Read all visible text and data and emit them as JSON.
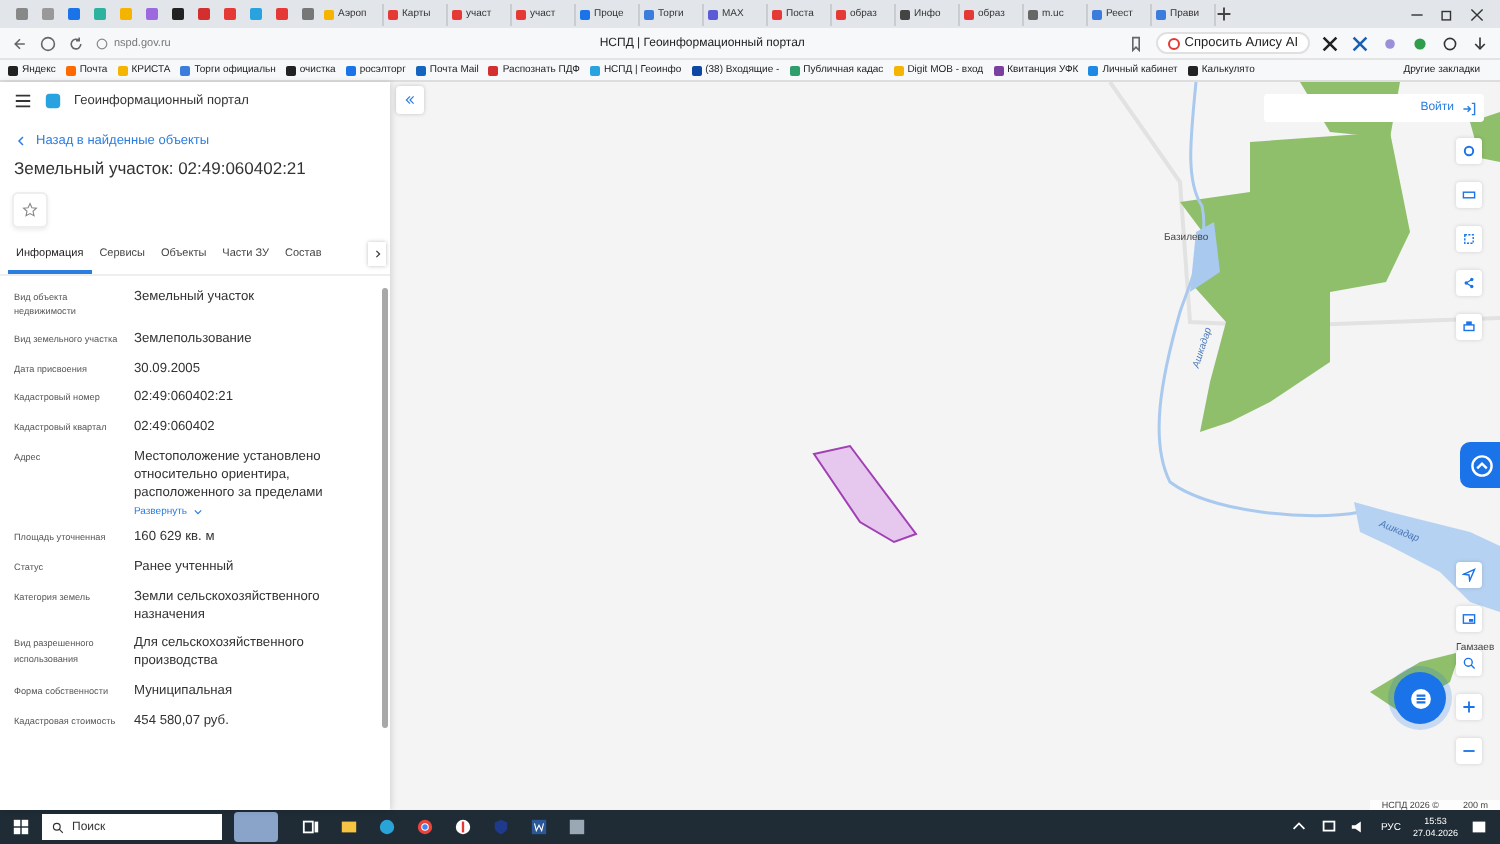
{
  "browser": {
    "tabs": [
      {
        "title": "Аэроп",
        "color": "#f5b400"
      },
      {
        "title": "Карты",
        "color": "#e53935"
      },
      {
        "title": "участ",
        "color": "#e53935"
      },
      {
        "title": "участ",
        "color": "#e53935"
      },
      {
        "title": "Проце",
        "color": "#1a73e8"
      },
      {
        "title": "Торги",
        "color": "#3b7ddd"
      },
      {
        "title": "MAX",
        "color": "#5b5bd6"
      },
      {
        "title": "Поста",
        "color": "#e53935"
      },
      {
        "title": "образ",
        "color": "#e53935"
      },
      {
        "title": "Инфо",
        "color": "#444444"
      },
      {
        "title": "образ",
        "color": "#e53935"
      },
      {
        "title": "m.uc",
        "color": "#666666"
      },
      {
        "title": "Реест",
        "color": "#3b7ddd"
      },
      {
        "title": "Прави",
        "color": "#3b7ddd"
      }
    ],
    "url": "nspd.gov.ru",
    "page_title": "НСПД | Геоинформационный портал",
    "alice_button": "Спросить Алису AI",
    "bookmarks": [
      {
        "label": "Яндекс",
        "color": "#222222"
      },
      {
        "label": "Почта",
        "color": "#ff6a00"
      },
      {
        "label": "КРИСТА",
        "color": "#f5b400"
      },
      {
        "label": "Торги официальн",
        "color": "#3b7ddd"
      },
      {
        "label": "очистка",
        "color": "#222222"
      },
      {
        "label": "росэлторг",
        "color": "#1a73e8"
      },
      {
        "label": "Почта Mail",
        "color": "#1565c0"
      },
      {
        "label": "Распознать ПДФ",
        "color": "#d32f2f"
      },
      {
        "label": "НСПД | Геоинфо",
        "color": "#29a3e0"
      },
      {
        "label": "(38) Входящие -",
        "color": "#0d47a1"
      },
      {
        "label": "Публичная кадас",
        "color": "#2e9e6a"
      },
      {
        "label": "Digit МОВ - вход",
        "color": "#f5b400"
      },
      {
        "label": "Квитанция УФК",
        "color": "#7b3fa0"
      },
      {
        "label": "Личный кабинет",
        "color": "#1e88e5"
      },
      {
        "label": "Калькулято",
        "color": "#222222"
      }
    ],
    "other_bookmarks": "Другие закладки"
  },
  "panel": {
    "portal_title": "Геоинформационный портал",
    "back_link": "Назад в найденные объекты",
    "title": "Земельный участок: 02:49:060402:21",
    "tabs": [
      {
        "label": "Информация",
        "selected": true
      },
      {
        "label": "Сервисы",
        "selected": false
      },
      {
        "label": "Объекты",
        "selected": false
      },
      {
        "label": "Части ЗУ",
        "selected": false
      },
      {
        "label": "Состав",
        "selected": false
      }
    ],
    "fields": [
      {
        "label": "Вид объекта недвижимости",
        "value": "Земельный участок"
      },
      {
        "label": "Вид земельного участка",
        "value": "Землепользование"
      },
      {
        "label": "Дата присвоения",
        "value": "30.09.2005"
      },
      {
        "label": "Кадастровый номер",
        "value": "02:49:060402:21"
      },
      {
        "label": "Кадастровый квартал",
        "value": "02:49:060402"
      },
      {
        "label": "Адрес",
        "value": "Местоположение установлено относительно ориентира, расположенного за пределами",
        "expand_link": "Развернуть"
      },
      {
        "label": "Площадь уточненная",
        "value": "160 629 кв. м"
      },
      {
        "label": "Статус",
        "value": "Ранее учтенный"
      },
      {
        "label": "Категория земель",
        "value": "Земли сельскохозяйственного назначения"
      },
      {
        "label": "Вид разрешенного использования",
        "value": "Для сельскохозяйственного производства"
      },
      {
        "label": "Форма собственности",
        "value": "Муниципальная"
      },
      {
        "label": "Кадастровая стоимость",
        "value": "454 580,07 руб."
      }
    ]
  },
  "map": {
    "login_button": "Войти",
    "places": [
      {
        "name": "Базилево",
        "kind": "settlement"
      },
      {
        "name": "Ашкадар",
        "kind": "river"
      },
      {
        "name": "Ашкадар",
        "kind": "river"
      },
      {
        "name": "Гамзаев",
        "kind": "settlement"
      }
    ],
    "copyright": "НСПД 2026 ©",
    "scale": "200 m"
  },
  "taskbar": {
    "search_placeholder": "Поиск",
    "language": "РУС",
    "time": "15:53",
    "date": "27.04.2026"
  }
}
